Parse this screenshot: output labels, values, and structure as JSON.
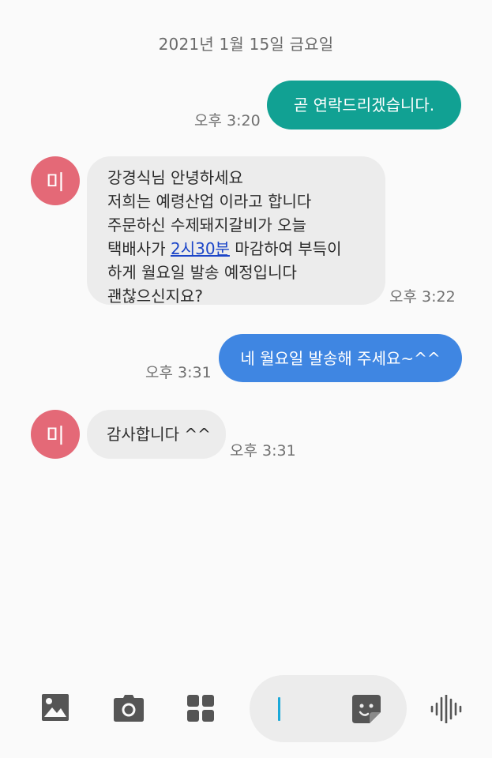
{
  "conversation": {
    "date_header": "2021년 1월 15일 금요일",
    "contact_initial": "미",
    "messages": [
      {
        "direction": "outgoing",
        "text": "곧 연락드리겠습니다.",
        "time": "오후 3:20",
        "color": "#11a193"
      },
      {
        "direction": "incoming",
        "lines": [
          "강경식님 안녕하세요",
          "저희는 예령산업 이라고 합니다",
          "주문하신 수제돼지갈비가 오늘"
        ],
        "line4_before": "택배사가 ",
        "link_text": "2시30분",
        "line4_after": " 마감하여 부득이",
        "lines_end": [
          "하게 월요일 발송 예정입니다",
          "괜찮으신지요?"
        ],
        "time": "오후 3:22"
      },
      {
        "direction": "outgoing",
        "text": "네 월요일 발송해 주세요~^^",
        "time": "오후 3:31",
        "color": "#3f86e2"
      },
      {
        "direction": "incoming",
        "text": "감사합니다 ^^",
        "time": "오후 3:31"
      }
    ]
  },
  "toolbar": {
    "icons": [
      "gallery-icon",
      "camera-icon",
      "apps-icon",
      "sticker-icon",
      "voice-icon"
    ]
  },
  "colors": {
    "avatar": "#e46977",
    "incoming_bubble": "#ececec",
    "link": "#1b45c8",
    "cursor": "#1ba9d9"
  }
}
